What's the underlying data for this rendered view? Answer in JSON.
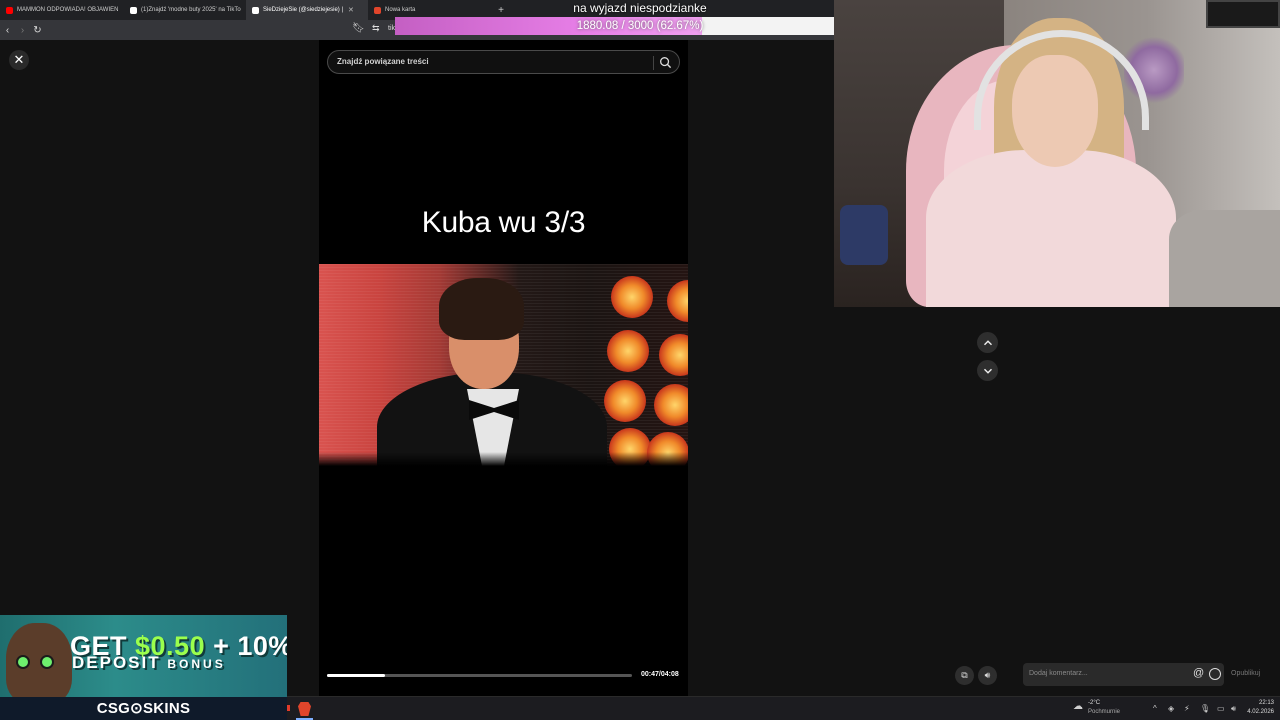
{
  "browser": {
    "tabs": [
      {
        "label": "MAMMON ODPOWIADA! OBJAWIEN",
        "favicon_color": "#ff0000",
        "active": false,
        "show_close": false
      },
      {
        "label": "(1)Znajdź 'modne buty 2025' na TikTo",
        "favicon_color": "#ffffff",
        "active": false,
        "show_close": false
      },
      {
        "label": "SieDziejeSie (@siedziejesie) |",
        "favicon_color": "#ffffff",
        "active": true,
        "show_close": true
      },
      {
        "label": "Nowa karta",
        "favicon_color": "#e1452b",
        "active": false,
        "show_close": false
      }
    ],
    "new_tab_icon": "+",
    "url_fragment": "tik"
  },
  "stream_goal": {
    "title": "na wyjazd niespodzianke",
    "current": 1880.08,
    "target": 3000,
    "progress_fraction": 0.6267,
    "progress_text": "1880.08 / 3000 (62.67%)",
    "fill_color": "#d46ad4"
  },
  "player": {
    "search_placeholder": "Znajdź powiązane treści",
    "caption": "Kuba wu 3/3",
    "time": "00:47/04:08",
    "progress_fraction": 0.19
  },
  "comment": {
    "placeholder": "Dodaj komentarz...",
    "at_icon": "@",
    "publish_label": "Opublikuj"
  },
  "ad": {
    "line1_a": "GET ",
    "line1_b": "$0.50",
    "line1_c": " + 10%",
    "line2_a": "DEPOSIT ",
    "line2_b": "BONUS",
    "brand_a": "CSG",
    "brand_sep": "⊙",
    "brand_b": "SKINS",
    "accent_color": "#9bff4d"
  },
  "taskbar": {
    "temperature": "-2°C",
    "condition": "Pochmurnie",
    "time": "22:13",
    "date": "4.02.2026"
  },
  "colors": {
    "background": "#121212",
    "player_bg": "#000000",
    "chrome_dark": "#202124"
  }
}
